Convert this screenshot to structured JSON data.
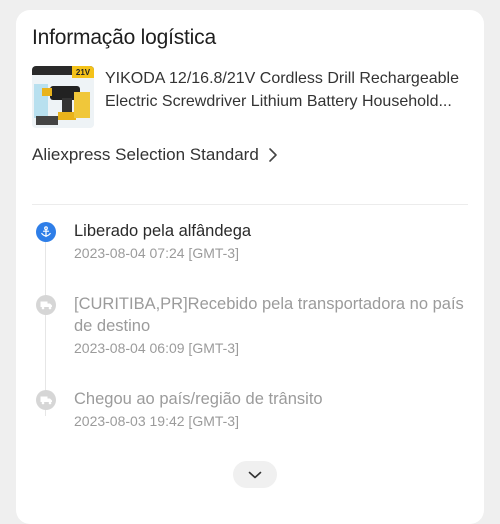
{
  "header": {
    "title": "Informação logística"
  },
  "product": {
    "thumb_badge": "21V",
    "title": "YIKODA 12/16.8/21V Cordless Drill Rechargeable Electric Screwdriver Lithium Battery Household..."
  },
  "shipping": {
    "label": "Aliexpress Selection Standard"
  },
  "timeline": {
    "events": [
      {
        "status": "active",
        "icon": "anchor-icon",
        "description": "Liberado pela alfândega",
        "time": "2023-08-04 07:24 [GMT-3]"
      },
      {
        "status": "inactive",
        "icon": "truck-icon",
        "description": "[CURITIBA,PR]Recebido pela transportadora no país de destino",
        "time": "2023-08-04 06:09 [GMT-3]"
      },
      {
        "status": "inactive",
        "icon": "truck-icon",
        "description": "Chegou ao país/região de trânsito",
        "time": "2023-08-03 19:42 [GMT-3]"
      }
    ]
  },
  "colors": {
    "accent": "#2e7ee8",
    "inactive_icon": "#d6d6d6",
    "muted_text": "#9b9b9b"
  }
}
